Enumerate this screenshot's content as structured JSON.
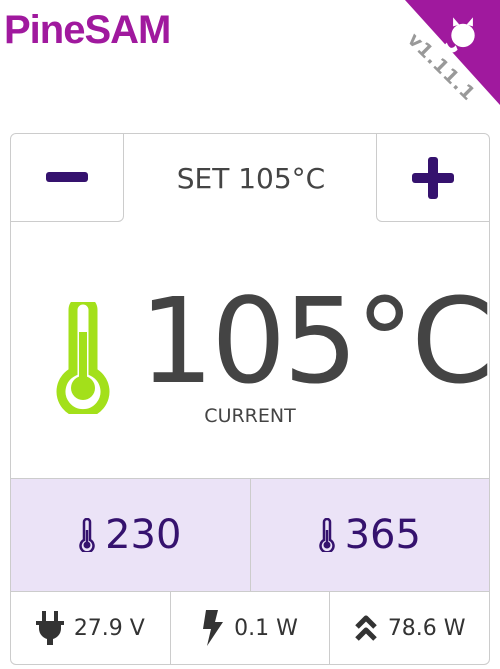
{
  "header": {
    "logo": "PineSAM",
    "version": "v1.11.1"
  },
  "control": {
    "decrease_label": "−",
    "increase_label": "+",
    "setpoint": "SET 105°C"
  },
  "display": {
    "current_temp": "105°C",
    "current_label": "CURRENT"
  },
  "presets": [
    {
      "value": "230"
    },
    {
      "value": "365"
    }
  ],
  "stats": [
    {
      "icon": "plug-icon",
      "value": "27.9 V"
    },
    {
      "icon": "bolt-icon",
      "value": "0.1 W"
    },
    {
      "icon": "double-chevron-up-icon",
      "value": "78.6 W"
    }
  ],
  "colors": {
    "brand": "#a0199e",
    "accent": "#35126e",
    "thermo": "#a3e01a",
    "preset_bg": "#ebe3f7"
  }
}
